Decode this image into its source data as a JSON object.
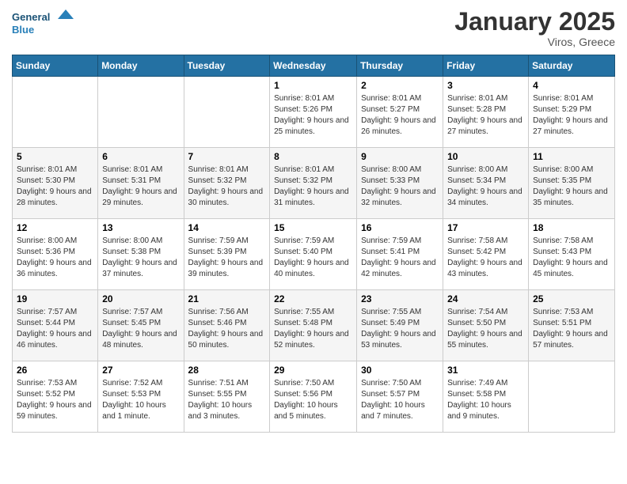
{
  "header": {
    "logo_general": "General",
    "logo_blue": "Blue",
    "month_title": "January 2025",
    "subtitle": "Viros, Greece"
  },
  "weekdays": [
    "Sunday",
    "Monday",
    "Tuesday",
    "Wednesday",
    "Thursday",
    "Friday",
    "Saturday"
  ],
  "weeks": [
    [
      {
        "day": "",
        "info": ""
      },
      {
        "day": "",
        "info": ""
      },
      {
        "day": "",
        "info": ""
      },
      {
        "day": "1",
        "info": "Sunrise: 8:01 AM\nSunset: 5:26 PM\nDaylight: 9 hours and 25 minutes."
      },
      {
        "day": "2",
        "info": "Sunrise: 8:01 AM\nSunset: 5:27 PM\nDaylight: 9 hours and 26 minutes."
      },
      {
        "day": "3",
        "info": "Sunrise: 8:01 AM\nSunset: 5:28 PM\nDaylight: 9 hours and 27 minutes."
      },
      {
        "day": "4",
        "info": "Sunrise: 8:01 AM\nSunset: 5:29 PM\nDaylight: 9 hours and 27 minutes."
      }
    ],
    [
      {
        "day": "5",
        "info": "Sunrise: 8:01 AM\nSunset: 5:30 PM\nDaylight: 9 hours and 28 minutes."
      },
      {
        "day": "6",
        "info": "Sunrise: 8:01 AM\nSunset: 5:31 PM\nDaylight: 9 hours and 29 minutes."
      },
      {
        "day": "7",
        "info": "Sunrise: 8:01 AM\nSunset: 5:32 PM\nDaylight: 9 hours and 30 minutes."
      },
      {
        "day": "8",
        "info": "Sunrise: 8:01 AM\nSunset: 5:32 PM\nDaylight: 9 hours and 31 minutes."
      },
      {
        "day": "9",
        "info": "Sunrise: 8:00 AM\nSunset: 5:33 PM\nDaylight: 9 hours and 32 minutes."
      },
      {
        "day": "10",
        "info": "Sunrise: 8:00 AM\nSunset: 5:34 PM\nDaylight: 9 hours and 34 minutes."
      },
      {
        "day": "11",
        "info": "Sunrise: 8:00 AM\nSunset: 5:35 PM\nDaylight: 9 hours and 35 minutes."
      }
    ],
    [
      {
        "day": "12",
        "info": "Sunrise: 8:00 AM\nSunset: 5:36 PM\nDaylight: 9 hours and 36 minutes."
      },
      {
        "day": "13",
        "info": "Sunrise: 8:00 AM\nSunset: 5:38 PM\nDaylight: 9 hours and 37 minutes."
      },
      {
        "day": "14",
        "info": "Sunrise: 7:59 AM\nSunset: 5:39 PM\nDaylight: 9 hours and 39 minutes."
      },
      {
        "day": "15",
        "info": "Sunrise: 7:59 AM\nSunset: 5:40 PM\nDaylight: 9 hours and 40 minutes."
      },
      {
        "day": "16",
        "info": "Sunrise: 7:59 AM\nSunset: 5:41 PM\nDaylight: 9 hours and 42 minutes."
      },
      {
        "day": "17",
        "info": "Sunrise: 7:58 AM\nSunset: 5:42 PM\nDaylight: 9 hours and 43 minutes."
      },
      {
        "day": "18",
        "info": "Sunrise: 7:58 AM\nSunset: 5:43 PM\nDaylight: 9 hours and 45 minutes."
      }
    ],
    [
      {
        "day": "19",
        "info": "Sunrise: 7:57 AM\nSunset: 5:44 PM\nDaylight: 9 hours and 46 minutes."
      },
      {
        "day": "20",
        "info": "Sunrise: 7:57 AM\nSunset: 5:45 PM\nDaylight: 9 hours and 48 minutes."
      },
      {
        "day": "21",
        "info": "Sunrise: 7:56 AM\nSunset: 5:46 PM\nDaylight: 9 hours and 50 minutes."
      },
      {
        "day": "22",
        "info": "Sunrise: 7:55 AM\nSunset: 5:48 PM\nDaylight: 9 hours and 52 minutes."
      },
      {
        "day": "23",
        "info": "Sunrise: 7:55 AM\nSunset: 5:49 PM\nDaylight: 9 hours and 53 minutes."
      },
      {
        "day": "24",
        "info": "Sunrise: 7:54 AM\nSunset: 5:50 PM\nDaylight: 9 hours and 55 minutes."
      },
      {
        "day": "25",
        "info": "Sunrise: 7:53 AM\nSunset: 5:51 PM\nDaylight: 9 hours and 57 minutes."
      }
    ],
    [
      {
        "day": "26",
        "info": "Sunrise: 7:53 AM\nSunset: 5:52 PM\nDaylight: 9 hours and 59 minutes."
      },
      {
        "day": "27",
        "info": "Sunrise: 7:52 AM\nSunset: 5:53 PM\nDaylight: 10 hours and 1 minute."
      },
      {
        "day": "28",
        "info": "Sunrise: 7:51 AM\nSunset: 5:55 PM\nDaylight: 10 hours and 3 minutes."
      },
      {
        "day": "29",
        "info": "Sunrise: 7:50 AM\nSunset: 5:56 PM\nDaylight: 10 hours and 5 minutes."
      },
      {
        "day": "30",
        "info": "Sunrise: 7:50 AM\nSunset: 5:57 PM\nDaylight: 10 hours and 7 minutes."
      },
      {
        "day": "31",
        "info": "Sunrise: 7:49 AM\nSunset: 5:58 PM\nDaylight: 10 hours and 9 minutes."
      },
      {
        "day": "",
        "info": ""
      }
    ]
  ]
}
